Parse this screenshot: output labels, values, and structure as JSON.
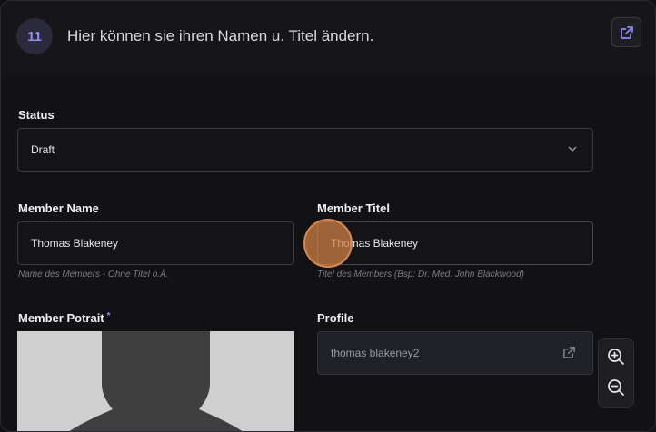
{
  "step": {
    "number": "11",
    "text": "Hier können sie ihren Namen u. Titel ändern."
  },
  "form": {
    "status": {
      "label": "Status",
      "value": "Draft"
    },
    "member_name": {
      "label": "Member Name",
      "value": "Thomas Blakeney",
      "hint": "Name des Members - Ohne Titel o.Ä."
    },
    "member_titel": {
      "label": "Member Titel",
      "value": "Thomas Blakeney",
      "hint": "Titel des Members (Bsp: Dr. Med. John Blackwood)"
    },
    "member_portrait": {
      "label": "Member Potrait",
      "required_marker": "*"
    },
    "profile": {
      "label": "Profile",
      "value": "thomas blakeney2"
    }
  },
  "icons": {
    "open": "external-link-icon",
    "status_chevron": "chevron-down-icon",
    "profile_link": "external-link-icon",
    "zoom_in": "zoom-in-icon",
    "zoom_out": "zoom-out-icon"
  },
  "colors": {
    "accent": "#8f8cf5",
    "cursor_highlight": "#d8894d"
  }
}
